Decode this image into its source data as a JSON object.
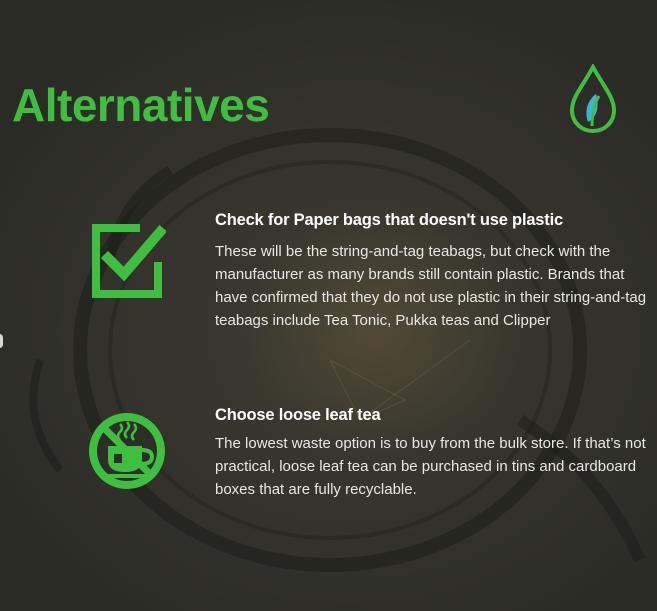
{
  "title": "Alternatives",
  "accent_color": "#3fbf3f",
  "logo_icon": "water-drop-leaf-icon",
  "items": [
    {
      "icon": "checkbox-check-icon",
      "heading": "Check for Paper bags that doesn't use plastic",
      "body": "These will be the string-and-tag teabags, but check with the manufacturer as many brands still contain plastic. Brands that have confirmed that they do not use plastic in their string-and-tag teabags include Tea Tonic, Pukka teas and Clipper"
    },
    {
      "icon": "no-teacup-icon",
      "heading": "Choose loose leaf tea",
      "body": "The lowest waste option is to buy from the bulk store. If that’s not practical, loose leaf tea can be purchased in tins and cardboard boxes that are fully recyclable."
    }
  ]
}
